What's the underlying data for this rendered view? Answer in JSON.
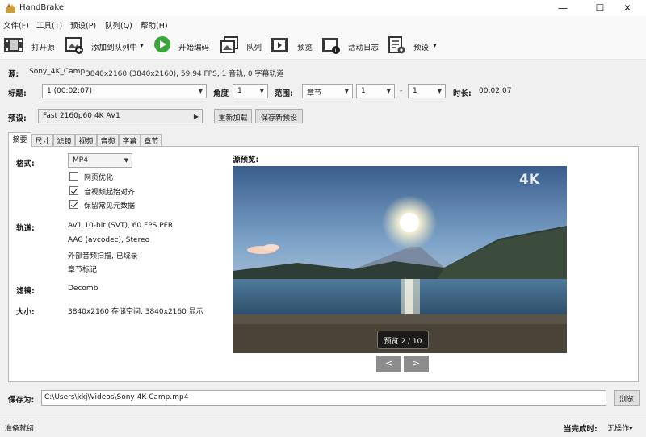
{
  "window": {
    "title": "HandBrake",
    "minimize": "—",
    "maximize": "☐",
    "close": "✕"
  },
  "menu": [
    "文件(F)",
    "工具(T)",
    "预设(P)",
    "队列(Q)",
    "帮助(H)"
  ],
  "toolbar": {
    "open_source": "打开源",
    "add_to_queue": "添加到队列中",
    "start_encode": "开始编码",
    "queue": "队列",
    "preview": "预览",
    "activity_log": "活动日志",
    "presets": "预设"
  },
  "source": {
    "label": "源:",
    "name": "Sony_4K_Camp",
    "info": "3840x2160 (3840x2160), 59.94 FPS, 1 音轨, 0 字幕轨道"
  },
  "title_row": {
    "title_label": "标题:",
    "title_value": "1  (00:02:07)",
    "angle_label": "角度",
    "angle_value": "1",
    "range_label": "范围:",
    "range_value": "章节",
    "range_start": "1",
    "range_sep": "-",
    "range_end": "1",
    "duration_label": "时长:",
    "duration_value": "00:02:07"
  },
  "preset_row": {
    "label": "预设:",
    "value": "Fast 2160p60 4K AV1",
    "reload": "重新加载",
    "save_new": "保存新预设"
  },
  "tabs": [
    "摘要",
    "尺寸",
    "滤镜",
    "视频",
    "音频",
    "字幕",
    "章节"
  ],
  "summary": {
    "format_label": "格式:",
    "format_value": "MP4",
    "checks": [
      {
        "label": "网页优化",
        "checked": false
      },
      {
        "label": "音视频起始对齐",
        "checked": true
      },
      {
        "label": "保留常见元数据",
        "checked": true
      }
    ],
    "tracks_label": "轨道:",
    "tracks": [
      "AV1 10-bit (SVT), 60 FPS PFR",
      "AAC (avcodec), Stereo",
      "外部音频扫描, 已烧录",
      "章节标记"
    ],
    "filters_label": "滤镜:",
    "filters_value": "Decomb",
    "size_label": "大小:",
    "size_value": "3840x2160 存储空间, 3840x2160 显示",
    "preview_label": "源预览:",
    "preview_badge": "预览 2 / 10",
    "preview_watermark": "4K",
    "prev": "<",
    "next": ">"
  },
  "save": {
    "label": "保存为:",
    "path": "C:\\Users\\kkj\\Videos\\Sony 4K Camp.mp4",
    "browse": "浏览"
  },
  "status": {
    "ready": "准备就绪",
    "when_done_label": "当完成时:",
    "when_done_value": "无操作▾"
  }
}
